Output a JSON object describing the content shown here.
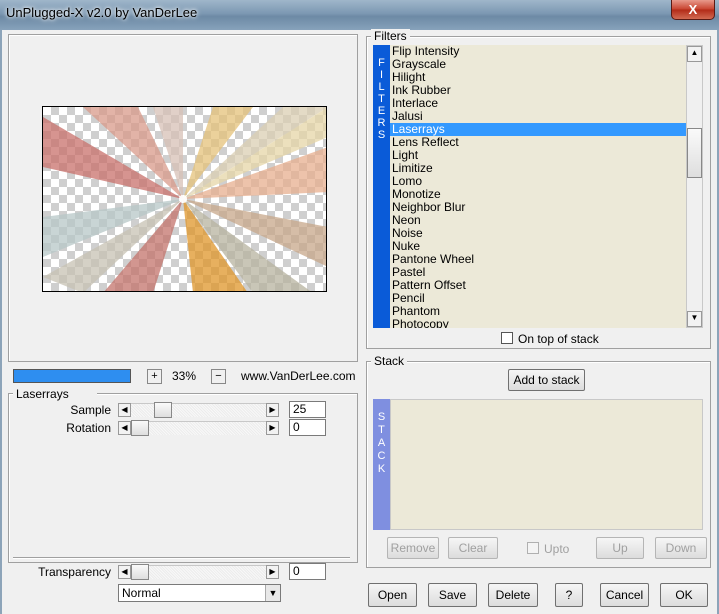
{
  "window": {
    "title": "UnPlugged-X v2.0 by VanDerLee",
    "close_glyph": "X"
  },
  "preview": {
    "zoom_in": "+",
    "zoom_out": "−",
    "zoom": "33%",
    "website": "www.VanDerLee.com"
  },
  "filters_panel": {
    "title": "Filters",
    "side_label": [
      "F",
      "I",
      "L",
      "T",
      "E",
      "R",
      "S"
    ],
    "items": [
      "Flip Intensity",
      "Grayscale",
      "Hilight",
      "Ink Rubber",
      "Interlace",
      "Jalusi",
      "Laserrays",
      "Lens Reflect",
      "Light",
      "Limitize",
      "Lomo",
      "Monotize",
      "Neighbor Blur",
      "Neon",
      "Noise",
      "Nuke",
      "Pantone Wheel",
      "Pastel",
      "Pattern Offset",
      "Pencil",
      "Phantom",
      "Photocopy"
    ],
    "selected": "Laserrays",
    "on_top_of_stack_label": "On top of stack",
    "on_top_checked": false
  },
  "params": {
    "group_title": "Laserrays",
    "sliders": [
      {
        "label": "Sample",
        "value": "25",
        "level": 0.2
      },
      {
        "label": "Rotation",
        "value": "0",
        "level": 0.0
      }
    ],
    "transparency": {
      "label": "Transparency",
      "value": "0",
      "level": 0.0
    },
    "blend_mode": "Normal"
  },
  "stack": {
    "title": "Stack",
    "add_label": "Add to stack",
    "side_label": [
      "S",
      "T",
      "A",
      "C",
      "K"
    ],
    "remove_label": "Remove",
    "clear_label": "Clear",
    "upto_label": "Upto",
    "up_label": "Up",
    "down_label": "Down"
  },
  "footer": {
    "open": "Open",
    "save": "Save",
    "delete": "Delete",
    "help": "?",
    "cancel": "Cancel",
    "ok": "OK"
  },
  "colors": {
    "selection": "#3399ff",
    "filter_sidebar": "#0a5bd8",
    "stack_sidebar": "#7f8fe0",
    "list_bg": "#ece9d8"
  }
}
